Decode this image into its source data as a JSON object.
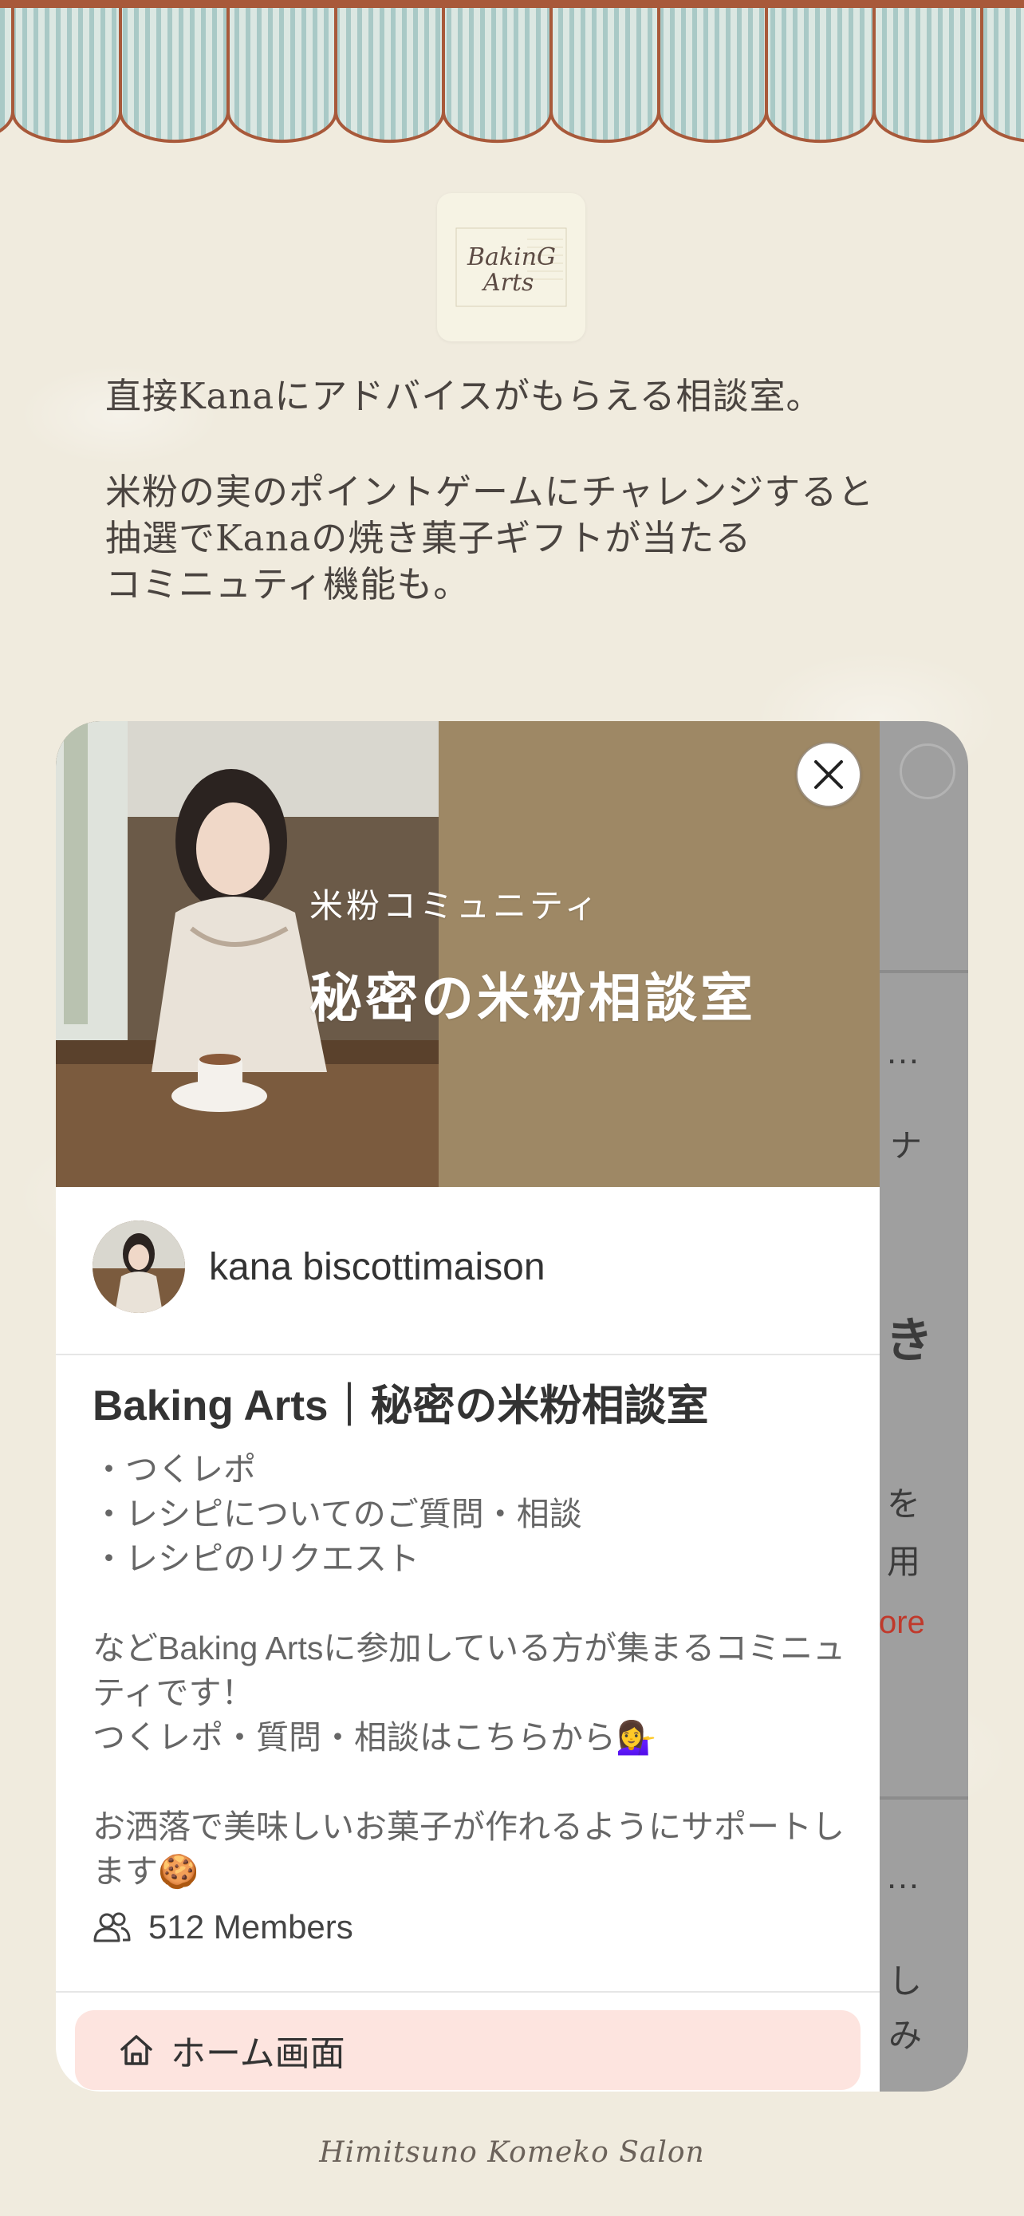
{
  "brand": {
    "logo_text": "Baking Arts",
    "footer": "Himitsuno Komeko Salon"
  },
  "intro": {
    "paragraph1": "直接Kanaにアドバイスがもらえる相談室。",
    "paragraph2_line1": "米粉の実のポイントゲームにチャレンジすると",
    "paragraph2_line2": "抽選でKanaの焼き菓子ギフトが当たる",
    "paragraph2_line3": "コミニュティ機能も。"
  },
  "peek": {
    "frag1": "…",
    "frag2": "ナ",
    "frag3": "き",
    "frag4": "を",
    "frag5": "用",
    "frag6": "ore",
    "frag7": "…",
    "frag8": "し",
    "frag9": "み"
  },
  "community": {
    "hero_subtitle": "米粉コミュニティ",
    "hero_title": "秘密の米粉相談室",
    "author": "kana biscottimaison",
    "title": "Baking Arts｜秘密の米粉相談室",
    "description": "・つくレポ\n・レシピについてのご質問・相談\n・レシピのリクエスト\n\nなどBaking Artsに参加している方が集まるコミニュティです！\nつくレポ・質問・相談はこちらから💁‍♀️\n\nお洒落で美味しいお菓子が作れるようにサポートします🍪",
    "members": "512 Members",
    "home_button": "ホーム画面"
  },
  "colors": {
    "background": "#f0ebde",
    "hero": "#9e8865",
    "home_button_bg": "#fde4df",
    "awning_stripe": "#a9c9c6",
    "awning_edge": "#a8593a",
    "peek_accent": "#c0392b"
  },
  "icons": {
    "close": "close-icon",
    "members": "users-icon",
    "home": "home-icon"
  }
}
